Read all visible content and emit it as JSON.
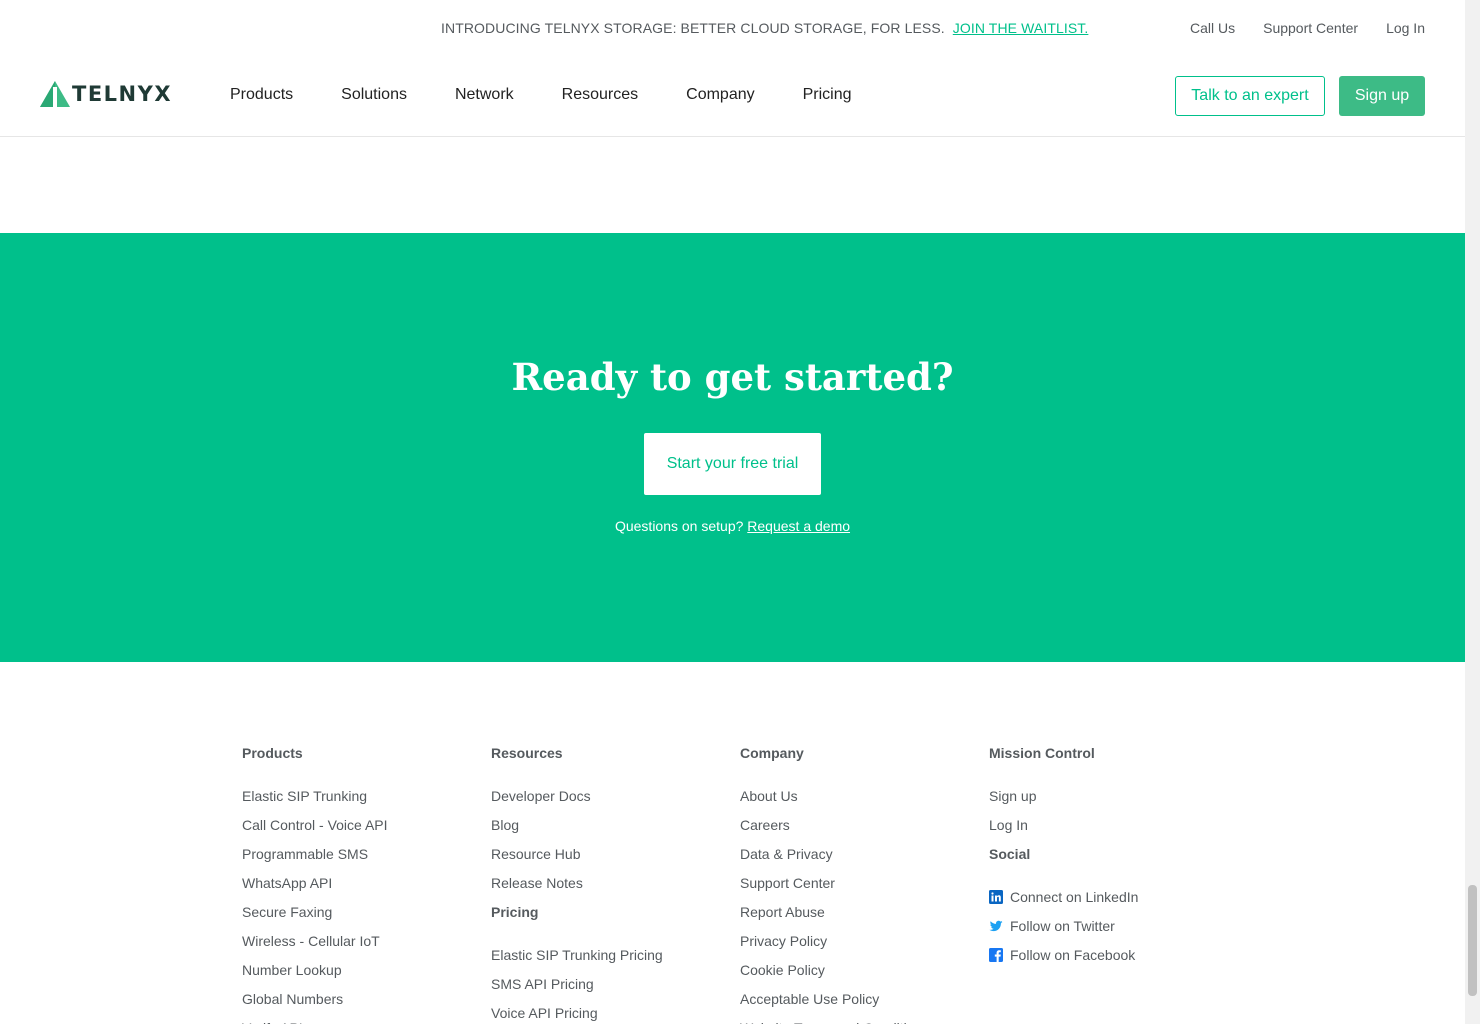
{
  "announcement": {
    "text": "INTRODUCING TELNYX STORAGE: BETTER CLOUD STORAGE, FOR LESS.",
    "link": "JOIN THE WAITLIST."
  },
  "utility_links": [
    "Call Us",
    "Support Center",
    "Log In"
  ],
  "header": {
    "logo_text": "TELNYX",
    "nav": [
      "Products",
      "Solutions",
      "Network",
      "Resources",
      "Company",
      "Pricing"
    ],
    "talk_expert": "Talk to an expert",
    "sign_up": "Sign up"
  },
  "cta": {
    "title": "Ready to get started?",
    "button": "Start your free trial",
    "question": "Questions on setup?",
    "demo_link": "Request a demo"
  },
  "footer": {
    "products": {
      "title": "Products",
      "items": [
        "Elastic SIP Trunking",
        "Call Control - Voice API",
        "Programmable SMS",
        "WhatsApp API",
        "Secure Faxing",
        "Wireless - Cellular IoT",
        "Number Lookup",
        "Global Numbers",
        "Verify API"
      ]
    },
    "resources": {
      "title": "Resources",
      "items": [
        "Developer Docs",
        "Blog",
        "Resource Hub",
        "Release Notes"
      ]
    },
    "pricing": {
      "title": "Pricing",
      "items": [
        "Elastic SIP Trunking Pricing",
        "SMS API Pricing",
        "Voice API Pricing"
      ]
    },
    "company": {
      "title": "Company",
      "items": [
        "About Us",
        "Careers",
        "Data & Privacy",
        "Support Center",
        "Report Abuse",
        "Privacy Policy",
        "Cookie Policy",
        "Acceptable Use Policy",
        "Website Terms and Conditions"
      ]
    },
    "mission_control": {
      "title": "Mission Control",
      "items": [
        "Sign up",
        "Log In"
      ]
    },
    "social": {
      "title": "Social",
      "items": [
        "Connect on LinkedIn",
        "Follow on Twitter",
        "Follow on Facebook"
      ]
    }
  },
  "colors": {
    "brand_green": "#00c08b",
    "button_green": "#3dbb86",
    "text_gray": "#555a5e",
    "linkedin_blue": "#0a66c2",
    "twitter_blue": "#1da1f2",
    "facebook_blue": "#1877f2"
  },
  "icons": {
    "logo": "telnyx-triangle-logo-icon",
    "linkedin": "linkedin-icon",
    "twitter": "twitter-icon",
    "facebook": "facebook-icon"
  }
}
